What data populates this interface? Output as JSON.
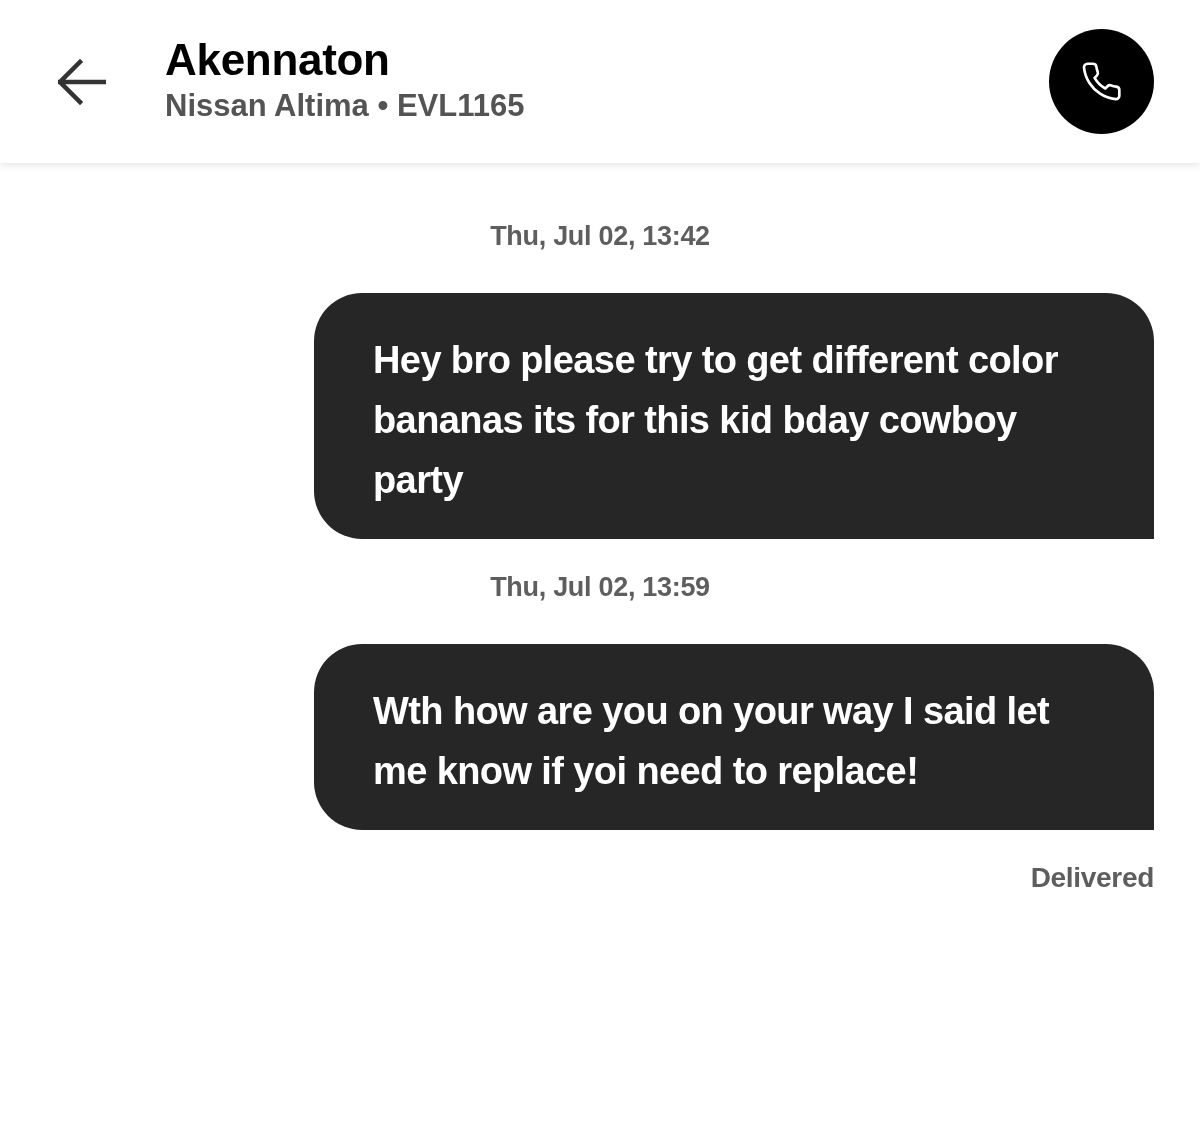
{
  "header": {
    "contact_name": "Akennaton",
    "vehicle": "Nissan Altima • EVL1165"
  },
  "messages": [
    {
      "timestamp": "Thu, Jul 02, 13:42",
      "kind": "outgoing",
      "text": "Hey bro please try to get different color bananas its for this kid bday cowboy party"
    },
    {
      "timestamp": "Thu, Jul 02, 13:59",
      "kind": "outgoing",
      "text": "Wth how are you on your way I said let me know if yoi need to replace!"
    }
  ],
  "delivery_status": "Delivered"
}
